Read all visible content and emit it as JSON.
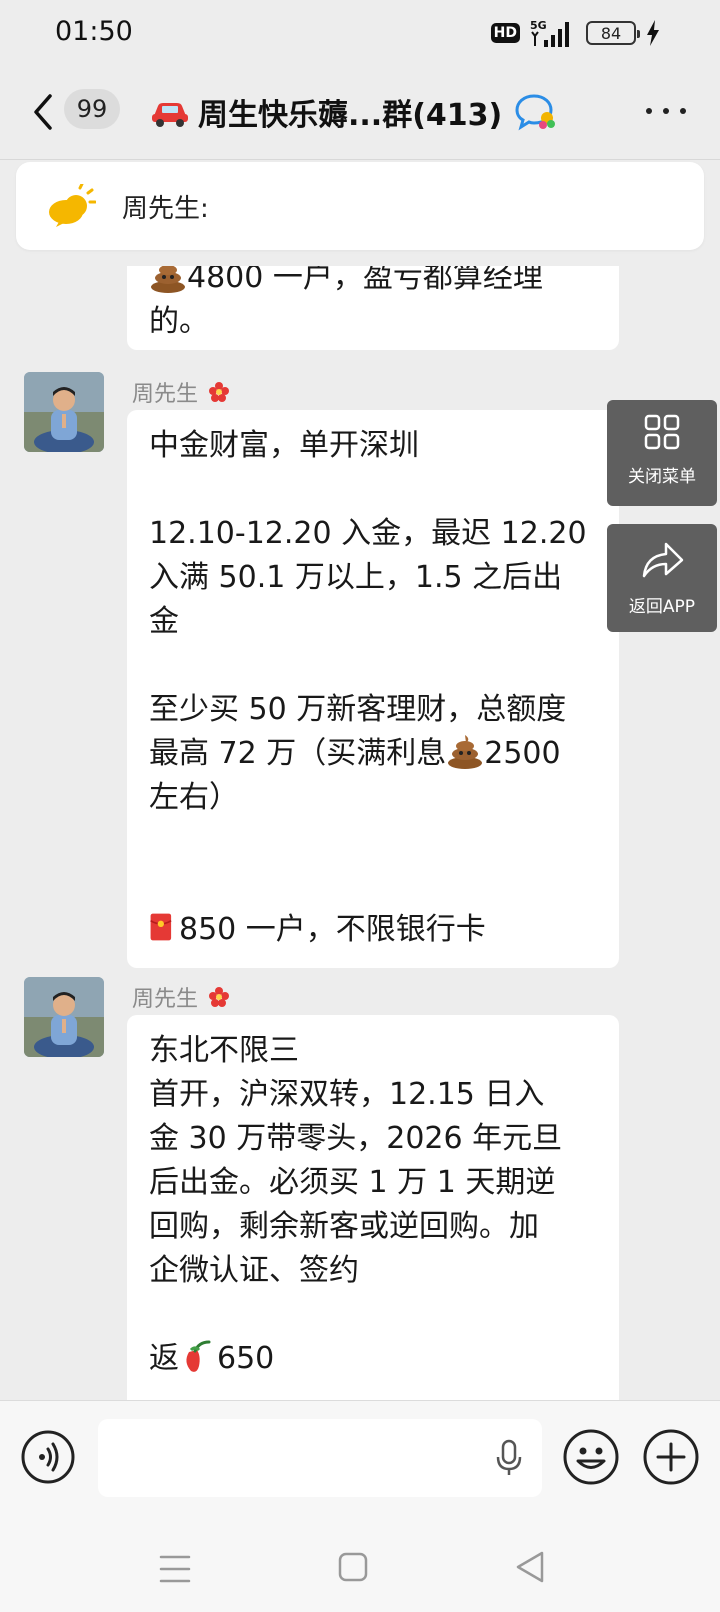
{
  "status_bar": {
    "time": "01:50",
    "hd": "HD",
    "network": "5G",
    "battery": "84"
  },
  "header": {
    "unread_count": "99",
    "title": "周生快乐薅...群(413)"
  },
  "pinned": {
    "text": "周先生:"
  },
  "messages": [
    {
      "sender": "",
      "lines": [
        "4800 一户，盈亏都算经理",
        "的。"
      ]
    },
    {
      "sender": "周先生",
      "lines": [
        "中金财富，单开深圳",
        "",
        "12.10-12.20 入金，最迟 12.20",
        "入满 50.1 万以上，1.5 之后出",
        "金",
        "",
        "至少买 50 万新客理财，总额度",
        "最高 72 万（买满利息",
        "2500",
        "左右）",
        "",
        "",
        "850 一户，不限银行卡"
      ]
    },
    {
      "sender": "周先生",
      "lines": [
        "东北不限三",
        "首开，沪深双转，12.15 日入",
        "金 30 万带零头，2026 年元旦",
        "后出金。必须买 1 万 1 天期逆",
        "回购，剩余新客或逆回购。加",
        "企微认证、签约",
        "",
        "返",
        "650"
      ]
    }
  ],
  "float_menu": {
    "close_menu": "关闭菜单",
    "back_app": "返回APP"
  },
  "icons": {
    "back": "back-arrow-icon",
    "car": "car-icon",
    "chat": "chat-bubble-icon",
    "more": "more-icon",
    "pinned": "sun-cloud-icon",
    "flower": "flower-icon",
    "poop": "poop-emoji-icon",
    "red_packet": "red-envelope-icon",
    "chili": "chili-emoji-icon",
    "voice": "voice-icon",
    "mic": "mic-icon",
    "emoji": "emoji-icon",
    "plus": "plus-icon"
  },
  "colors": {
    "background": "#ededed",
    "bubble": "#ffffff",
    "float_button": "#5f5f5f",
    "accent_red": "#e53935"
  }
}
